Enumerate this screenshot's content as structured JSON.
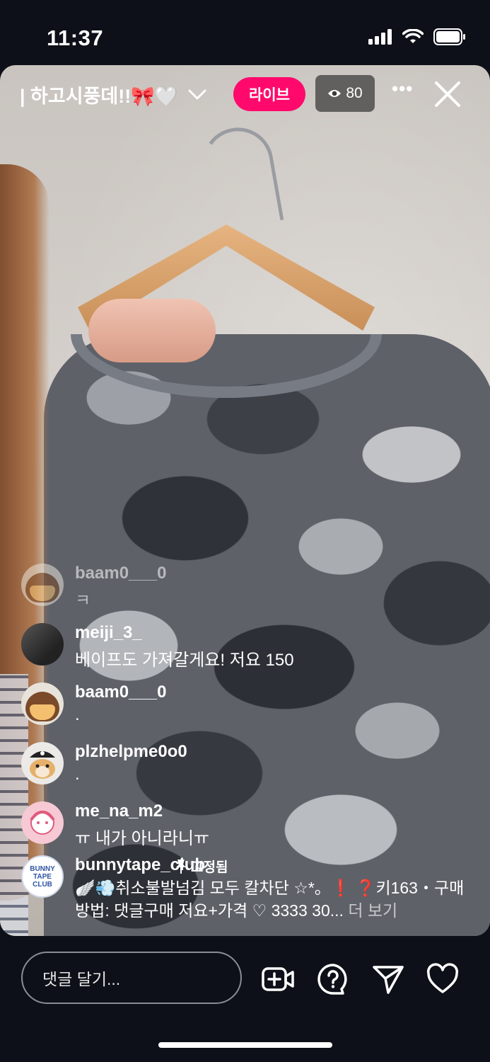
{
  "status_bar": {
    "time": "11:37"
  },
  "live": {
    "title": "| 하고시풍데!!🎀🤍",
    "badge_label": "라이브",
    "viewer_count": "80",
    "more_label": "•••"
  },
  "comments": [
    {
      "user": "baam0___0",
      "text": "ㅋ",
      "avatar": "chestnut",
      "faded": true
    },
    {
      "user": "meiji_3_",
      "text": "베이프도 가져갈게요! 저요 150",
      "avatar": "dark-photo"
    },
    {
      "user": "baam0___0",
      "text": ".",
      "avatar": "chestnut"
    },
    {
      "user": "plzhelpme0o0",
      "text": ".",
      "avatar": "pirate-hamster"
    },
    {
      "user": "me_na_m2",
      "text": "ㅠ 내가 아니라니ㅠ",
      "avatar": "pink-drawing"
    }
  ],
  "pinned_comment": {
    "user": "bunnytape_club",
    "pinned_label": "고정됨",
    "avatar_text": "BUNNY TAPE CLUB",
    "text": "🪽💨취소불발넘김 모두 칼차단 ☆*。❗ ❓키163・구매방법: 댓글구매 저요+가격 ♡ 3333 30...",
    "more_label": "더 보기"
  },
  "bottom_bar": {
    "comment_placeholder": "댓글 달기...",
    "icons": [
      "add-video-icon",
      "question-icon",
      "send-icon",
      "heart-icon"
    ]
  }
}
